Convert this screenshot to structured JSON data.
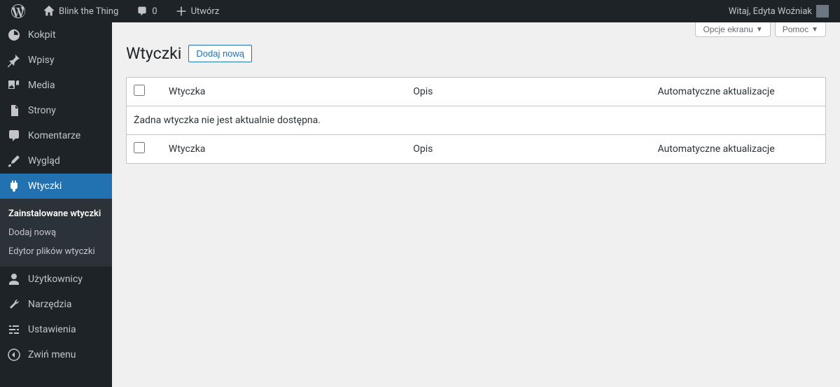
{
  "adminBar": {
    "siteName": "Blink the Thing",
    "commentsCount": "0",
    "newLabel": "Utwórz",
    "greeting": "Witaj, Edyta Woźniak"
  },
  "sidebar": {
    "dashboard": "Kokpit",
    "posts": "Wpisy",
    "media": "Media",
    "pages": "Strony",
    "comments": "Komentarze",
    "appearance": "Wygląd",
    "plugins": "Wtyczki",
    "users": "Użytkownicy",
    "tools": "Narzędzia",
    "settings": "Ustawienia",
    "collapse": "Zwiń menu",
    "submenu": {
      "installed": "Zainstalowane wtyczki",
      "addNew": "Dodaj nową",
      "editor": "Edytor plików wtyczki"
    }
  },
  "screenMeta": {
    "options": "Opcje ekranu",
    "help": "Pomoc"
  },
  "page": {
    "title": "Wtyczki",
    "addNew": "Dodaj nową"
  },
  "table": {
    "colPlugin": "Wtyczka",
    "colDesc": "Opis",
    "colAuto": "Automatyczne aktualizacje",
    "noItems": "Żadna wtyczka nie jest aktualnie dostępna."
  }
}
